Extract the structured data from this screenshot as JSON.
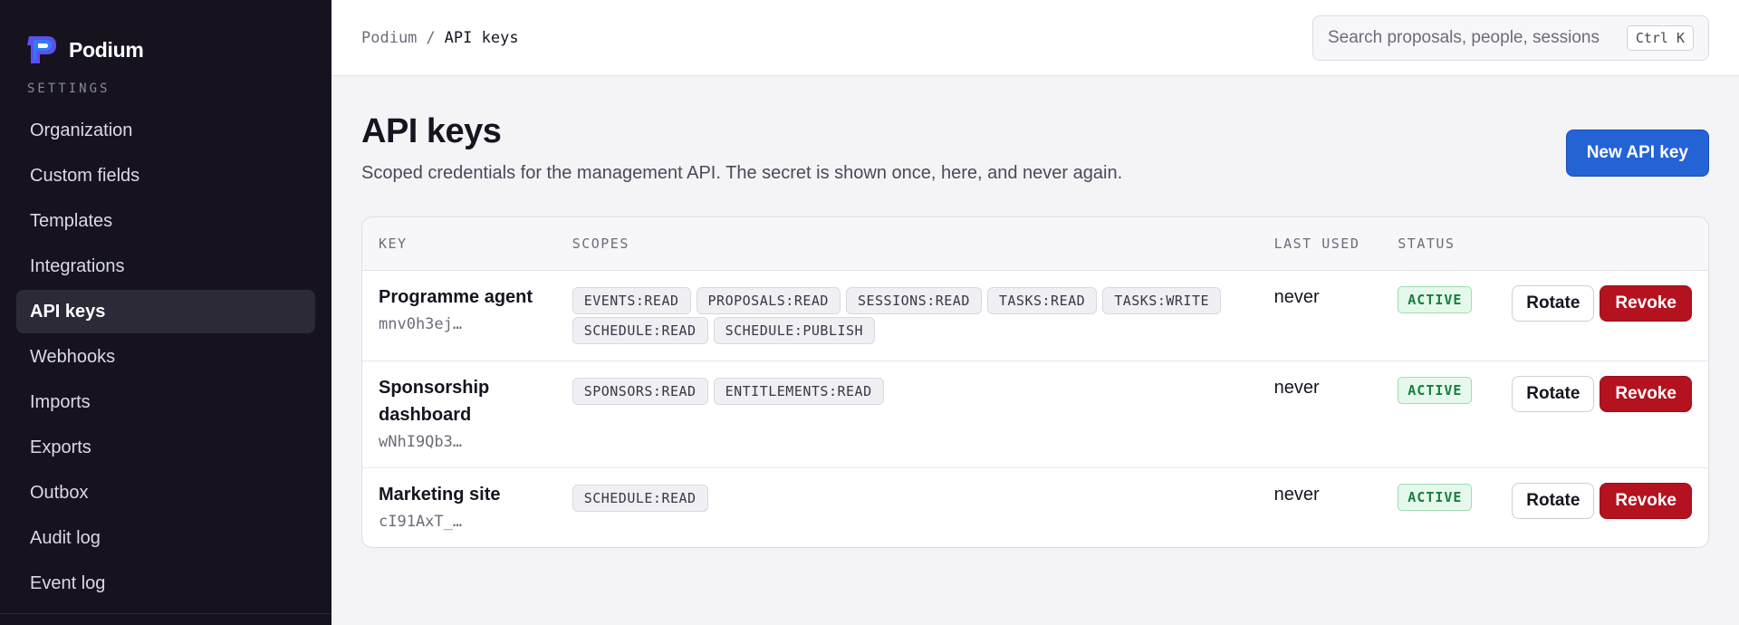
{
  "brand": {
    "name": "Podium",
    "logo_icon": "podium-logo-icon"
  },
  "sidebar": {
    "section_label": "SETTINGS",
    "items": [
      {
        "label": "Organization",
        "active": false
      },
      {
        "label": "Custom fields",
        "active": false
      },
      {
        "label": "Templates",
        "active": false
      },
      {
        "label": "Integrations",
        "active": false
      },
      {
        "label": "API keys",
        "active": true
      },
      {
        "label": "Webhooks",
        "active": false
      },
      {
        "label": "Imports",
        "active": false
      },
      {
        "label": "Exports",
        "active": false
      },
      {
        "label": "Outbox",
        "active": false
      },
      {
        "label": "Audit log",
        "active": false
      },
      {
        "label": "Event log",
        "active": false
      }
    ]
  },
  "topbar": {
    "breadcrumb": {
      "root": "Podium",
      "separator": "/",
      "current": "API keys"
    },
    "search": {
      "placeholder": "Search proposals, people, sessions",
      "shortcut": "Ctrl K"
    }
  },
  "page": {
    "title": "API keys",
    "description": "Scoped credentials for the management API. The secret is shown once, here, and never again.",
    "new_button": "New API key"
  },
  "table": {
    "headers": {
      "key": "KEY",
      "scopes": "SCOPES",
      "last_used": "LAST USED",
      "status": "STATUS"
    },
    "rows": [
      {
        "name": "Programme agent",
        "prefix": "mnv0h3ej…",
        "scopes": [
          "EVENTS:READ",
          "PROPOSALS:READ",
          "SESSIONS:READ",
          "TASKS:READ",
          "TASKS:WRITE",
          "SCHEDULE:READ",
          "SCHEDULE:PUBLISH"
        ],
        "last_used": "never",
        "status": "ACTIVE",
        "rotate": "Rotate",
        "revoke": "Revoke"
      },
      {
        "name": "Sponsorship dashboard",
        "prefix": "wNhI9Qb3…",
        "scopes": [
          "SPONSORS:READ",
          "ENTITLEMENTS:READ"
        ],
        "last_used": "never",
        "status": "ACTIVE",
        "rotate": "Rotate",
        "revoke": "Revoke"
      },
      {
        "name": "Marketing site",
        "prefix": "cI91AxT_…",
        "scopes": [
          "SCHEDULE:READ"
        ],
        "last_used": "never",
        "status": "ACTIVE",
        "rotate": "Rotate",
        "revoke": "Revoke"
      }
    ]
  },
  "colors": {
    "accent": "#2463d6",
    "danger": "#b4121f",
    "success": "#16803d",
    "sidebar_bg": "#16131f"
  }
}
